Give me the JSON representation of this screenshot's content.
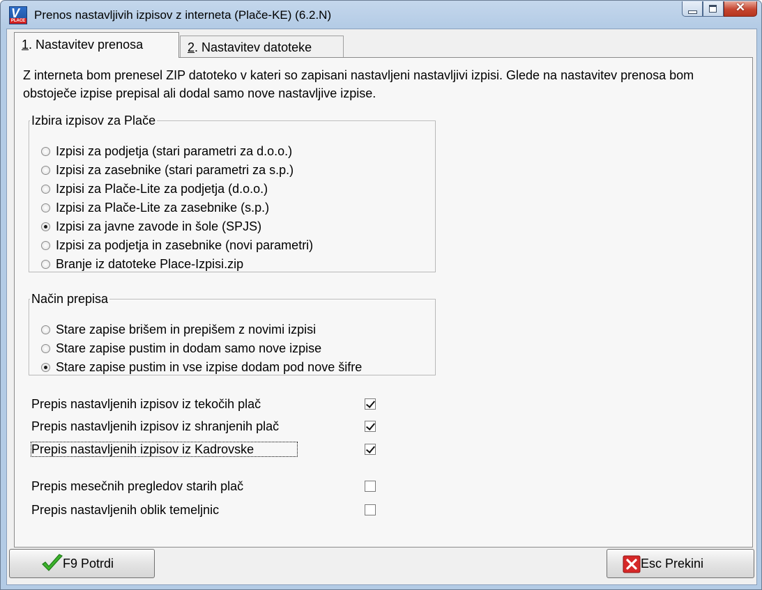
{
  "window": {
    "title": "Prenos nastavljivih izpisov z interneta (Plače-KE)  (6.2.N)",
    "icon_text": "V",
    "icon_tag": "PLACE"
  },
  "tabs": [
    {
      "key": "1",
      "label": ". Nastavitev prenosa",
      "active": true
    },
    {
      "key": "2",
      "label": ". Nastavitev datoteke",
      "active": false
    }
  ],
  "intro": "Z interneta bom prenesel ZIP datoteko v kateri so zapisani nastavljeni nastavljivi izpisi. Glede na nastavitev prenosa bom obstoječe izpise prepisal ali dodal samo nove nastavljive izpise.",
  "selection_group": {
    "legend": "Izbira izpisov za Plače",
    "options": [
      {
        "label": "Izpisi za podjetja (stari parametri za d.o.o.)",
        "selected": false
      },
      {
        "label": "Izpisi za zasebnike (stari parametri za s.p.)",
        "selected": false
      },
      {
        "label": "Izpisi za Plače-Lite za podjetja (d.o.o.)",
        "selected": false
      },
      {
        "label": "Izpisi za Plače-Lite za zasebnike (s.p.)",
        "selected": false
      },
      {
        "label": "Izpisi za javne zavode in šole (SPJS)",
        "selected": true
      },
      {
        "label": "Izpisi za podjetja in zasebnike (novi parametri)",
        "selected": false
      },
      {
        "label": "Branje iz datoteke Place-Izpisi.zip",
        "selected": false
      }
    ]
  },
  "mode_group": {
    "legend": "Način prepisa",
    "options": [
      {
        "label": "Stare zapise brišem in prepišem z novimi izpisi",
        "selected": false
      },
      {
        "label": "Stare zapise pustim in dodam samo nove izpise",
        "selected": false
      },
      {
        "label": "Stare zapise pustim in vse izpise dodam pod nove šifre",
        "selected": true
      }
    ]
  },
  "checkboxes": [
    {
      "label": "Prepis nastavljenih izpisov iz tekočih plač",
      "checked": true
    },
    {
      "label": "Prepis nastavljenih izpisov iz shranjenih plač",
      "checked": true
    },
    {
      "label": "Prepis nastavljenih izpisov iz Kadrovske",
      "checked": true
    },
    {
      "label": "Prepis mesečnih pregledov starih plač",
      "checked": false
    },
    {
      "label": "Prepis nastavljenih oblik temeljnic",
      "checked": false
    }
  ],
  "buttons": {
    "confirm": "F9 Potrdi",
    "cancel": "Esc Prekini"
  },
  "colors": {
    "title_bar": "#b9cfe8",
    "close_button": "#c6452f",
    "dialog_bg": "#f0f0f0",
    "check_icon": "#3db32c",
    "cancel_icon": "#d62828"
  }
}
